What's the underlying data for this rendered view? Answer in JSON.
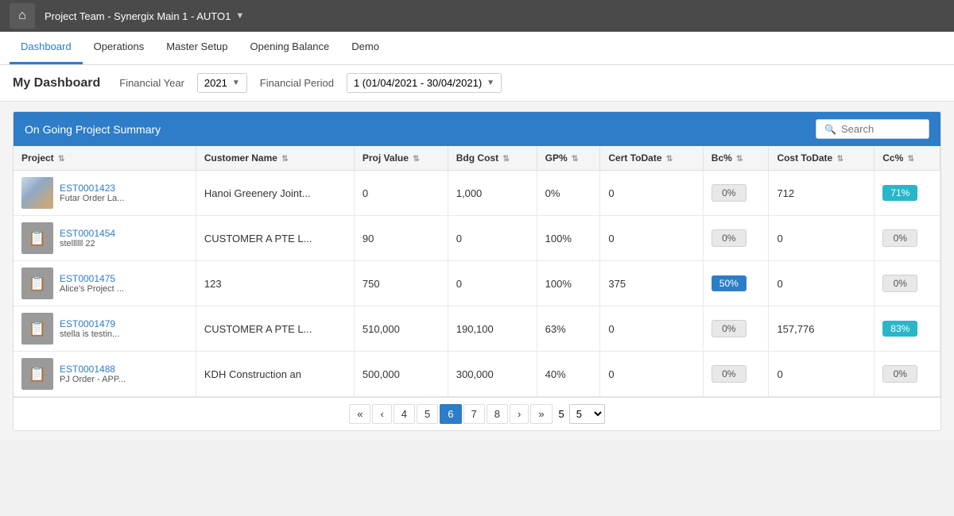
{
  "topbar": {
    "title": "Project Team - Synergix Main 1 - AUTO1",
    "home_icon": "🏠"
  },
  "nav": {
    "items": [
      {
        "id": "dashboard",
        "label": "Dashboard",
        "active": true
      },
      {
        "id": "operations",
        "label": "Operations",
        "active": false
      },
      {
        "id": "master-setup",
        "label": "Master Setup",
        "active": false
      },
      {
        "id": "opening-balance",
        "label": "Opening Balance",
        "active": false
      },
      {
        "id": "demo",
        "label": "Demo",
        "active": false
      }
    ]
  },
  "dashboard": {
    "title": "My Dashboard",
    "financial_year_label": "Financial Year",
    "financial_year_value": "2021",
    "financial_period_label": "Financial Period",
    "financial_period_value": "1 (01/04/2021 - 30/04/2021)"
  },
  "table": {
    "title": "On Going Project Summary",
    "search_placeholder": "Search",
    "columns": [
      {
        "id": "project",
        "label": "Project"
      },
      {
        "id": "customer_name",
        "label": "Customer Name"
      },
      {
        "id": "proj_value",
        "label": "Proj Value"
      },
      {
        "id": "bdg_cost",
        "label": "Bdg Cost"
      },
      {
        "id": "gp_pct",
        "label": "GP%"
      },
      {
        "id": "cert_todate",
        "label": "Cert ToDate"
      },
      {
        "id": "bc_pct",
        "label": "Bc%"
      },
      {
        "id": "cost_todate",
        "label": "Cost ToDate"
      },
      {
        "id": "cc_pct",
        "label": "Cc%"
      }
    ],
    "rows": [
      {
        "id": "EST0001423",
        "name": "Futar Order La...",
        "thumb_type": "photo",
        "customer": "Hanoi Greenery Joint...",
        "proj_value": "0",
        "bdg_cost": "1,000",
        "gp_pct": "0%",
        "cert_todate": "0",
        "bc_pct": "0%",
        "bc_style": "gray",
        "cost_todate": "712",
        "cc_pct": "71%",
        "cc_style": "cyan"
      },
      {
        "id": "EST0001454",
        "name": "stellllll 22",
        "thumb_type": "gray",
        "customer": "CUSTOMER A PTE L...",
        "proj_value": "90",
        "bdg_cost": "0",
        "gp_pct": "100%",
        "cert_todate": "0",
        "bc_pct": "0%",
        "bc_style": "gray",
        "cost_todate": "0",
        "cc_pct": "0%",
        "cc_style": "gray"
      },
      {
        "id": "EST0001475",
        "name": "Alice's Project ...",
        "thumb_type": "gray",
        "customer": "123",
        "proj_value": "750",
        "bdg_cost": "0",
        "gp_pct": "100%",
        "cert_todate": "375",
        "bc_pct": "50%",
        "bc_style": "blue",
        "cost_todate": "0",
        "cc_pct": "0%",
        "cc_style": "gray"
      },
      {
        "id": "EST0001479",
        "name": "stella is testin...",
        "thumb_type": "gray",
        "customer": "CUSTOMER A PTE L...",
        "proj_value": "510,000",
        "bdg_cost": "190,100",
        "gp_pct": "63%",
        "cert_todate": "0",
        "bc_pct": "0%",
        "bc_style": "gray",
        "cost_todate": "157,776",
        "cc_pct": "83%",
        "cc_style": "cyan"
      },
      {
        "id": "EST0001488",
        "name": "PJ Order - APP...",
        "thumb_type": "gray",
        "customer": "KDH Construction an",
        "proj_value": "500,000",
        "bdg_cost": "300,000",
        "gp_pct": "40%",
        "cert_todate": "0",
        "bc_pct": "0%",
        "bc_style": "gray",
        "cost_todate": "0",
        "cc_pct": "0%",
        "cc_style": "gray"
      }
    ]
  },
  "pagination": {
    "pages": [
      "«",
      "‹",
      "4",
      "5",
      "6",
      "7",
      "8",
      "›",
      "»"
    ],
    "active_page": "6",
    "page_size": "5"
  }
}
